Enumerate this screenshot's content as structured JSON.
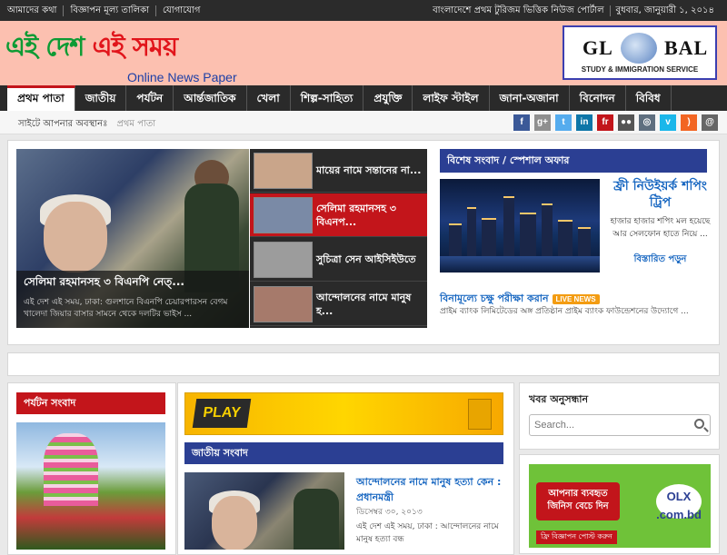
{
  "topbar": {
    "left_links": [
      "আমাদের কথা",
      "বিজ্ঞাপন মূল্য তালিকা",
      "যোগাযোগ"
    ],
    "tagline": "বাংলাদেশে প্রথম টুরিজম ভিত্তিক নিউজ পোর্টাল",
    "date": "বুধবার, জানুয়ারী ১, ২০১৪"
  },
  "header": {
    "logo_part1": "এই দেশ ",
    "logo_part2": "এই সময়",
    "logo_sub": "Online News Paper",
    "ad": {
      "text_left": "GL",
      "text_right": "BAL",
      "subtitle": "STUDY & IMMIGRATION SERVICE"
    }
  },
  "nav": {
    "items": [
      "প্রথম পাতা",
      "জাতীয়",
      "পর্যটন",
      "আর্ন্তজাতিক",
      "খেলা",
      "শিল্প-সাহিত্য",
      "প্রযুক্তি",
      "লাইফ স্টাইল",
      "জানা-অজানা",
      "বিনোদন",
      "বিবিধ"
    ],
    "active_index": 0
  },
  "breadcrumb": {
    "label": "সাইটে আপনার অবস্থানঃ",
    "current": "প্রথম পাতা"
  },
  "social": [
    {
      "name": "facebook-icon",
      "glyph": "f",
      "color": "#3b5998"
    },
    {
      "name": "googleplus-icon",
      "glyph": "g+",
      "color": "#8f8f8f"
    },
    {
      "name": "twitter-icon",
      "glyph": "t",
      "color": "#55acee"
    },
    {
      "name": "linkedin-icon",
      "glyph": "in",
      "color": "#0e76a8"
    },
    {
      "name": "friendfeed-icon",
      "glyph": "fr",
      "color": "#c2151b"
    },
    {
      "name": "flickr-icon",
      "glyph": "●●",
      "color": "#555555"
    },
    {
      "name": "delicious-icon",
      "glyph": "◎",
      "color": "#5f6f7f"
    },
    {
      "name": "vimeo-icon",
      "glyph": "v",
      "color": "#1ab7ea"
    },
    {
      "name": "rss-icon",
      "glyph": ")",
      "color": "#f26522"
    },
    {
      "name": "email-icon",
      "glyph": "@",
      "color": "#666666"
    }
  ],
  "slider": {
    "main_headline": "সেলিমা রহমানসহ ৩ বিএনপি নেত্...",
    "main_desc": "এই দেশ এই সময়, ঢাকা: গুলশানে বিএনপি চেয়ারপারসন বেগম খালেদা জিয়ার বাসার সামনে থেকে দলটির ভাইস ...",
    "thumbs": [
      {
        "title": "মায়ের নামে সন্তানের না...",
        "color": "#c9a58a"
      },
      {
        "title": "সেলিমা রহমানসহ ৩ বিএনপ...",
        "color": "#7a8aa6"
      },
      {
        "title": "সুচিত্রা সেন আইসিইউতে",
        "color": "#9c9c9c"
      },
      {
        "title": "আন্দোলনের নামে মানুষ হ...",
        "color": "#a67a6b"
      }
    ],
    "selected_index": 1
  },
  "special": {
    "heading": "বিশেষ সংবাদ / স্পেশাল অফার",
    "offer_title": "ফ্রী নিউইয়র্ক শপিং ট্রিপ",
    "offer_desc": "হাজার হাজার শপিং মল হয়েছে আর সেলফোন হাতে নিয়ে ...",
    "offer_more": "বিস্তারিত পড়ুন",
    "eye_title": "বিনামূল্যে চক্ষু পরীক্ষা করান",
    "eye_badge": "LIVE NEWS",
    "eye_desc": "প্রাইম ব্যাংক লিমিটেডের অঙ্গ প্রতিষ্ঠান প্রাইম ব্যাংক ফাউন্ডেশনের উদ্যোগে ..."
  },
  "tourism": {
    "heading": "পর্যটন সংবাদ"
  },
  "ad_play": {
    "text": "PLAY"
  },
  "national": {
    "heading": "জাতীয় সংবাদ",
    "title": "আন্দোলনের নামে মানুষ হত্যা কেন : প্রধানমন্ত্রী",
    "date": "ডিসেম্বর ৩০, ২০১৩",
    "desc": "এই দেশ এই সময়, ঢাকা : আন্দোলনের নামে মানুষ হত্যা বন্ধ"
  },
  "search": {
    "heading": "খবর অনুসন্ধান",
    "placeholder": "Search..."
  },
  "olx_ad": {
    "bubble": "আপনার ব্যবহৃত জিনিস বেচে দিন",
    "badge": "OLX .com.bd",
    "foot": "ফ্রি বিজ্ঞাপন পোস্ট করুন"
  }
}
